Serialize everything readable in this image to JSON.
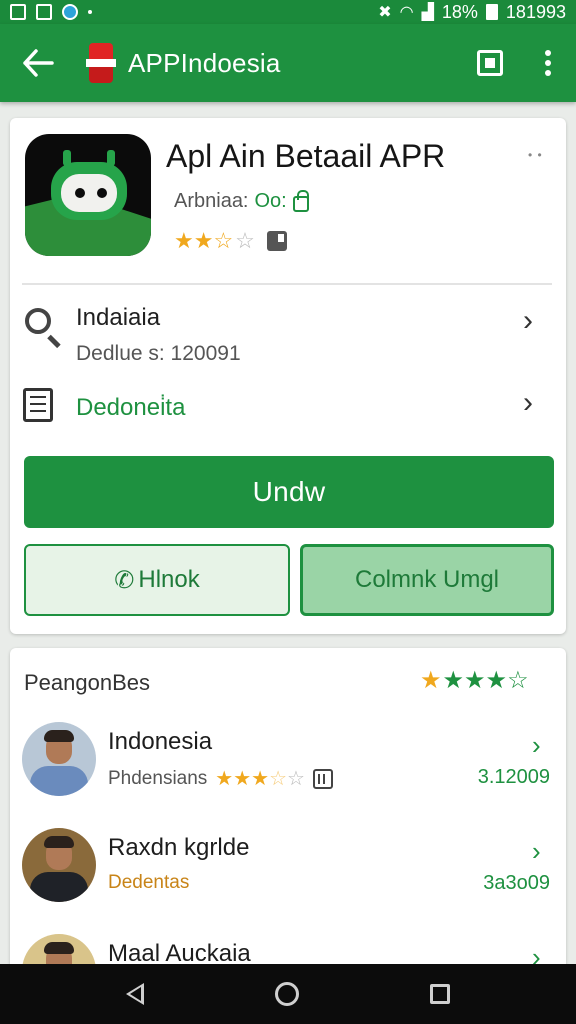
{
  "status_bar": {
    "battery": "18%",
    "time": "181993"
  },
  "app_bar": {
    "title": "APPIndoesia"
  },
  "app_header": {
    "title": "Apl Ain Betaail APR",
    "dev_label": "Arbniaa:",
    "dev_code": "Oo:",
    "rating_stars": "★★☆",
    "rating_rest": "☆"
  },
  "rows": {
    "search_title": "Indaiaia",
    "search_sub": "Dedlue s: 120091",
    "list_title": "Dedonei̇ta"
  },
  "buttons": {
    "primary": "Undw",
    "left": "Hlnok",
    "right": "Colmnk Umgl"
  },
  "reviews": {
    "header": "PeangonBes",
    "stars_gold": "★",
    "stars_green": "★★★☆",
    "items": [
      {
        "name": "Indonesia",
        "sub": "Phdensians",
        "stars_on": "★★★",
        "stars_half": "☆",
        "stars_off": "☆",
        "number": "3.12009"
      },
      {
        "name": "Raxdn kgrlde",
        "sub": "Dedentas",
        "number": "3a3o09"
      },
      {
        "name": "Maal Auckaia"
      }
    ]
  },
  "colors": {
    "primary_green": "#1e9140",
    "star_gold": "#f0a81e"
  }
}
